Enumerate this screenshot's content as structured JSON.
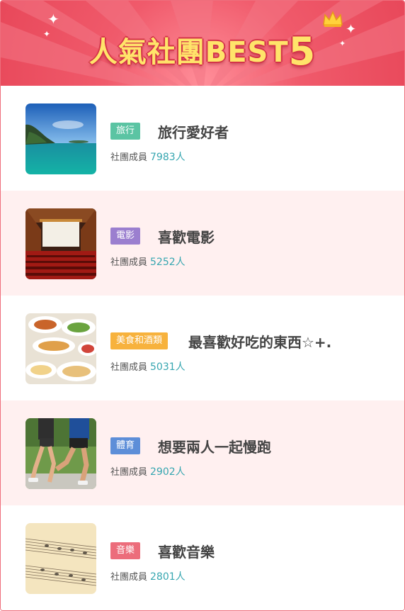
{
  "banner": {
    "title_text": "人氣社團BEST",
    "title_number": "5"
  },
  "member_label": "社團成員",
  "groups": [
    {
      "category": "旅行",
      "category_color": "#5bc4a3",
      "name": "旅行愛好者",
      "members": "7983人",
      "image": "beach-image"
    },
    {
      "category": "電影",
      "category_color": "#9b7fcf",
      "name": "喜歡電影",
      "members": "5252人",
      "image": "cinema-image"
    },
    {
      "category": "美食和酒類",
      "category_color": "#f7b23d",
      "name": "最喜歡好吃的東西☆+.",
      "members": "5031人",
      "image": "food-image"
    },
    {
      "category": "體育",
      "category_color": "#5d8ed8",
      "name": "想要兩人一起慢跑",
      "members": "2902人",
      "image": "running-image"
    },
    {
      "category": "音樂",
      "category_color": "#ec6d7b",
      "name": "喜歡音樂",
      "members": "2801人",
      "image": "sheet-music-image"
    }
  ]
}
